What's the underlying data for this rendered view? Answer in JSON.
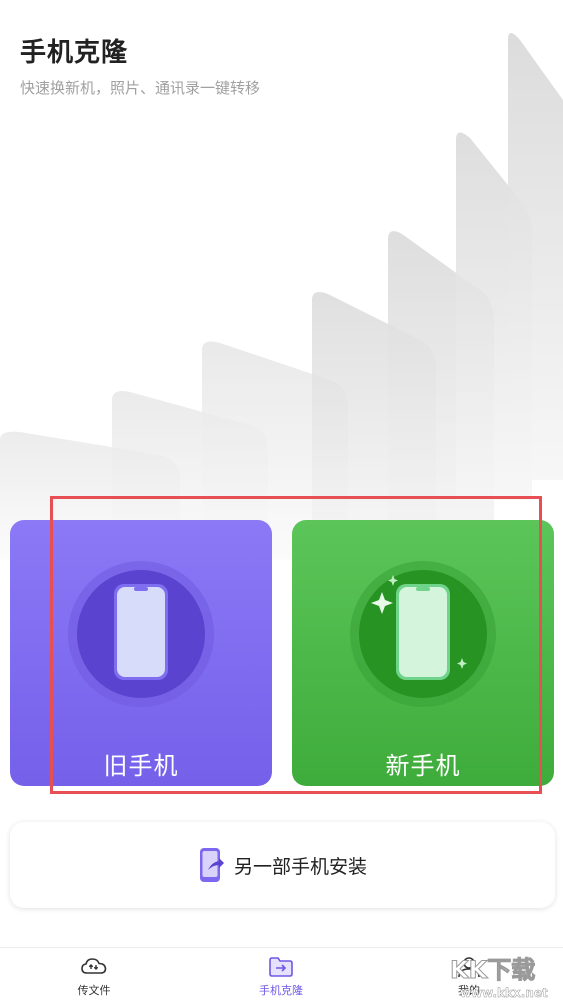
{
  "header": {
    "title": "手机克隆",
    "subtitle": "快速换新机，照片、通讯录一键转移"
  },
  "cards": {
    "old_phone_label": "旧手机",
    "new_phone_label": "新手机"
  },
  "install": {
    "label": "另一部手机安装",
    "icon": "phone-share-icon"
  },
  "tabbar": {
    "items": [
      {
        "label": "传文件",
        "icon": "cloud-transfer-icon",
        "active": false
      },
      {
        "label": "手机克隆",
        "icon": "folder-transfer-icon",
        "active": true
      },
      {
        "label": "我的",
        "icon": "person-icon",
        "active": false
      }
    ]
  },
  "watermark": {
    "text": "KK下载",
    "url": "www.kkx.net"
  },
  "colors": {
    "purple": "#7560ea",
    "green": "#3eac3b",
    "highlight": "#e84f55",
    "active_tab": "#6f58e6"
  }
}
